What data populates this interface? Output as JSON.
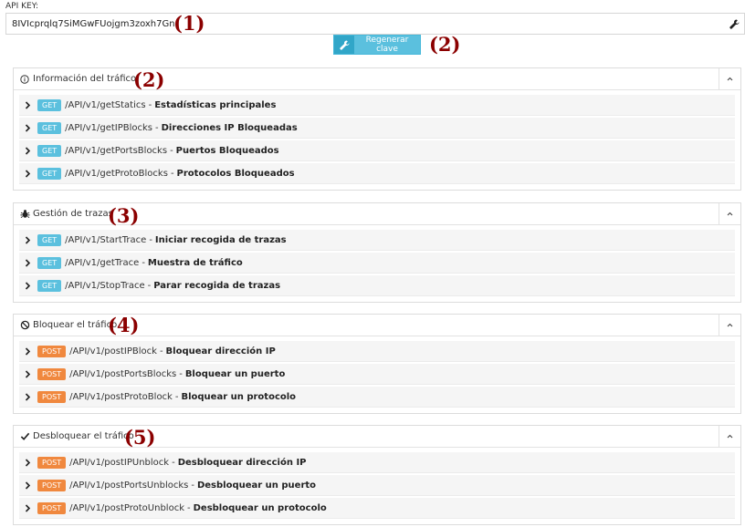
{
  "apikey": {
    "label": "API KEY:",
    "value": "8IVIcprqlq7SiMGwFUojgm3zoxh7Gn"
  },
  "regen_button": {
    "label": "Regenerar clave"
  },
  "annotations": [
    "(1)",
    "(2)",
    "(2)",
    "(3)",
    "(4)",
    "(5)"
  ],
  "separator": "-",
  "panels": [
    {
      "title": "Información del tráfico",
      "icon": "info-icon",
      "items": [
        {
          "method": "GET",
          "path": "/API/v1/getStatics",
          "desc": "Estadísticas principales"
        },
        {
          "method": "GET",
          "path": "/API/v1/getIPBlocks",
          "desc": "Direcciones IP Bloqueadas"
        },
        {
          "method": "GET",
          "path": "/API/v1/getPortsBlocks",
          "desc": "Puertos Bloqueados"
        },
        {
          "method": "GET",
          "path": "/API/v1/getProtoBlocks",
          "desc": "Protocolos Bloqueados"
        }
      ]
    },
    {
      "title": "Gestión de trazas",
      "icon": "bug-icon",
      "items": [
        {
          "method": "GET",
          "path": "/API/v1/StartTrace",
          "desc": "Iniciar recogida de trazas"
        },
        {
          "method": "GET",
          "path": "/API/v1/getTrace",
          "desc": "Muestra de tráfico"
        },
        {
          "method": "GET",
          "path": "/API/v1/StopTrace",
          "desc": "Parar recogida de trazas"
        }
      ]
    },
    {
      "title": "Bloquear el tráfico",
      "icon": "ban-icon",
      "items": [
        {
          "method": "POST",
          "path": "/API/v1/postIPBlock",
          "desc": "Bloquear dirección IP"
        },
        {
          "method": "POST",
          "path": "/API/v1/postPortsBlocks",
          "desc": "Bloquear un puerto"
        },
        {
          "method": "POST",
          "path": "/API/v1/postProtoBlock",
          "desc": "Bloquear un protocolo"
        }
      ]
    },
    {
      "title": "Desbloquear el tráfico",
      "icon": "check-icon",
      "items": [
        {
          "method": "POST",
          "path": "/API/v1/postIPUnblock",
          "desc": "Desbloquear dirección IP"
        },
        {
          "method": "POST",
          "path": "/API/v1/postPortsUnblocks",
          "desc": "Desbloquear un puerto"
        },
        {
          "method": "POST",
          "path": "/API/v1/postProtoUnblock",
          "desc": "Desbloquear un protocolo"
        }
      ]
    }
  ]
}
